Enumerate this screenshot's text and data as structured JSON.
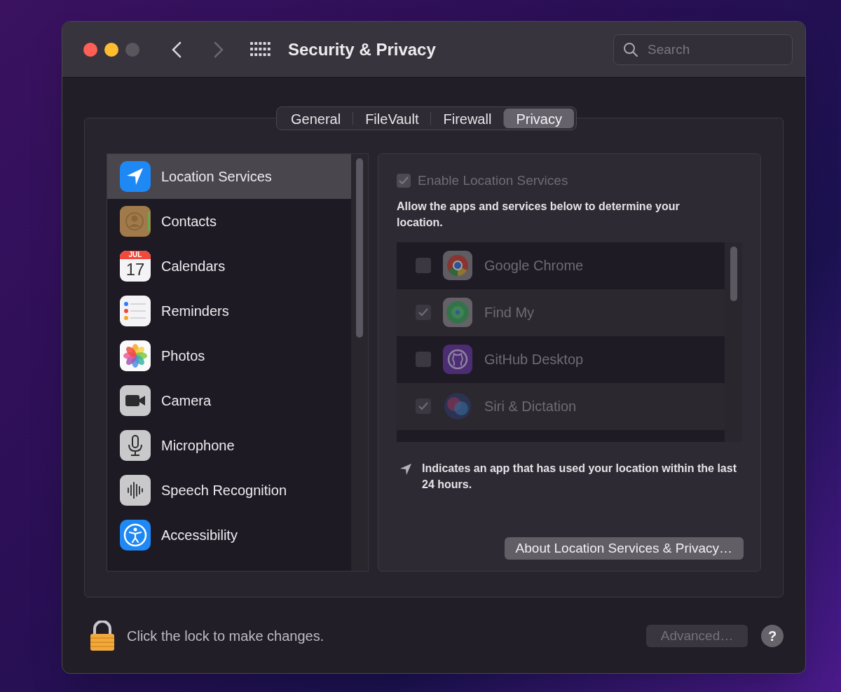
{
  "window": {
    "title": "Security & Privacy"
  },
  "search": {
    "placeholder": "Search"
  },
  "tabs": [
    {
      "label": "General",
      "selected": false
    },
    {
      "label": "FileVault",
      "selected": false
    },
    {
      "label": "Firewall",
      "selected": false
    },
    {
      "label": "Privacy",
      "selected": true
    }
  ],
  "sidebar": {
    "items": [
      {
        "label": "Location Services",
        "selected": true
      },
      {
        "label": "Contacts",
        "selected": false
      },
      {
        "label": "Calendars",
        "selected": false
      },
      {
        "label": "Reminders",
        "selected": false
      },
      {
        "label": "Photos",
        "selected": false
      },
      {
        "label": "Camera",
        "selected": false
      },
      {
        "label": "Microphone",
        "selected": false
      },
      {
        "label": "Speech Recognition",
        "selected": false
      },
      {
        "label": "Accessibility",
        "selected": false
      }
    ]
  },
  "calendar_icon": {
    "month": "JUL",
    "day": "17"
  },
  "location": {
    "disabled": true,
    "enable": {
      "label": "Enable Location Services",
      "checked": true
    },
    "description": "Allow the apps and services below to determine your location.",
    "apps": [
      {
        "name": "Google Chrome",
        "checked": false
      },
      {
        "name": "Find My",
        "checked": true
      },
      {
        "name": "GitHub Desktop",
        "checked": false
      },
      {
        "name": "Siri & Dictation",
        "checked": true
      }
    ],
    "note": "Indicates an app that has used your location within the last 24 hours.",
    "about_button": "About Location Services & Privacy…"
  },
  "footer": {
    "lock_text": "Click the lock to make changes.",
    "advanced_button": {
      "label": "Advanced…",
      "disabled": true
    },
    "help_button": "?"
  }
}
